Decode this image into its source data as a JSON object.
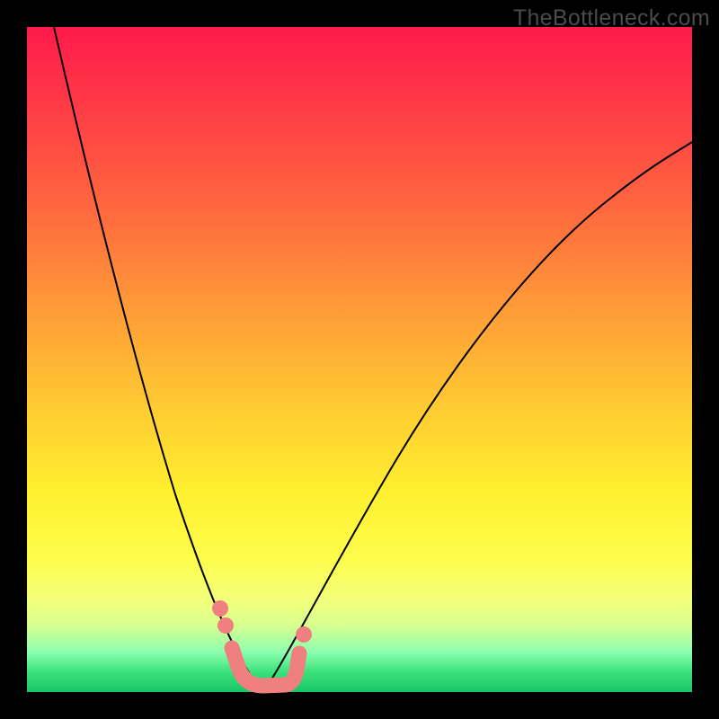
{
  "watermark": "TheBottleneck.com",
  "chart_data": {
    "type": "line",
    "title": "",
    "xlabel": "",
    "ylabel": "",
    "xlim": [
      0,
      100
    ],
    "ylim": [
      0,
      100
    ],
    "grid": false,
    "background_gradient": [
      "#ff1a4b",
      "#ff9a38",
      "#fff02e",
      "#19c566"
    ],
    "series": [
      {
        "name": "left-curve",
        "x": [
          4,
          8,
          12,
          16,
          20,
          24,
          27,
          30,
          33,
          35
        ],
        "y": [
          100,
          78,
          58,
          41,
          27,
          16,
          9,
          4,
          1,
          0
        ]
      },
      {
        "name": "right-curve",
        "x": [
          35,
          38,
          42,
          48,
          55,
          63,
          72,
          82,
          92,
          100
        ],
        "y": [
          0,
          3,
          10,
          22,
          36,
          50,
          62,
          72,
          79,
          83
        ]
      },
      {
        "name": "accent-band-u",
        "x": [
          27,
          30,
          32,
          34,
          36,
          38,
          40
        ],
        "y": [
          11,
          3,
          1,
          0,
          0,
          2,
          8
        ]
      }
    ],
    "colors": {
      "curve": "#000000",
      "accent": "#f08080"
    }
  }
}
